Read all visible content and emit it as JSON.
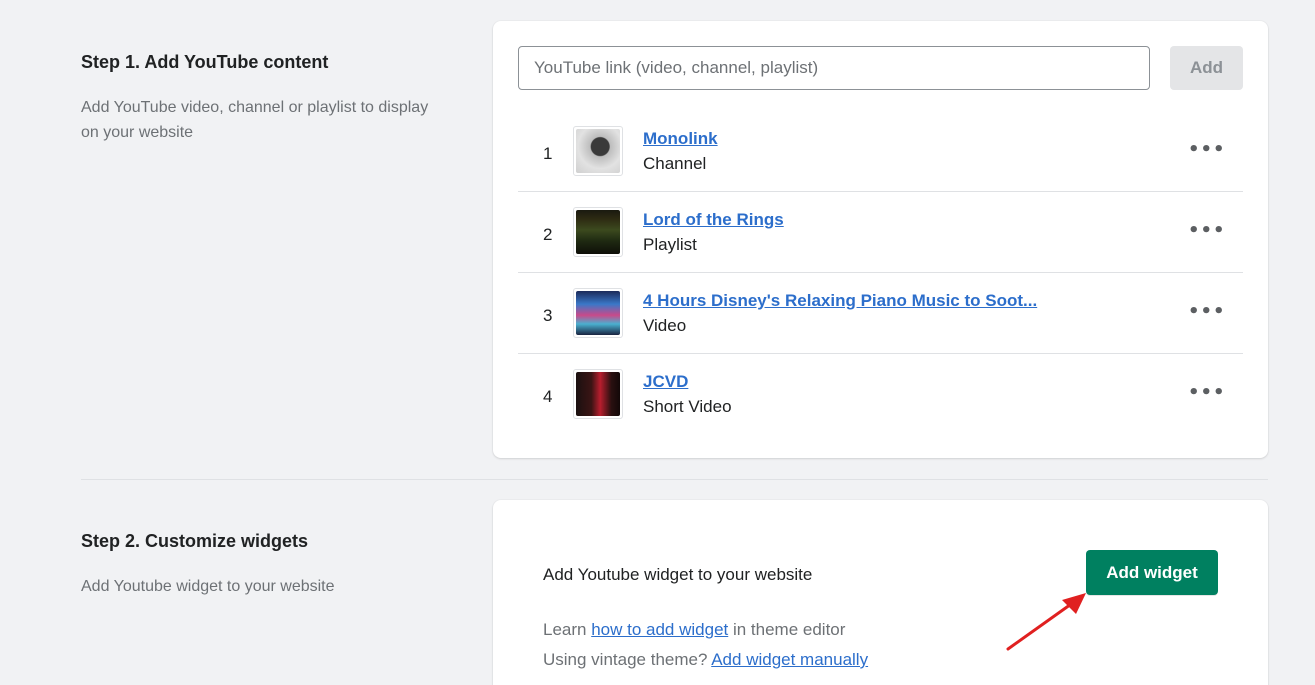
{
  "step1": {
    "title": "Step 1. Add YouTube content",
    "description": "Add YouTube video, channel or playlist to display on your website",
    "input_placeholder": "YouTube link (video, channel, playlist)",
    "add_label": "Add",
    "items": [
      {
        "num": "1",
        "title": "Monolink",
        "type": "Channel",
        "thumb": "avatar-gray"
      },
      {
        "num": "2",
        "title": "Lord of the Rings",
        "type": "Playlist",
        "thumb": "dark-green"
      },
      {
        "num": "3",
        "title": "4 Hours Disney's Relaxing Piano Music to Soot...",
        "type": "Video",
        "thumb": "colorful"
      },
      {
        "num": "4",
        "title": "JCVD",
        "type": "Short Video",
        "thumb": "dark-red"
      }
    ]
  },
  "step2": {
    "title": "Step 2. Customize widgets",
    "description": "Add Youtube widget to your website",
    "widget_text": "Add Youtube widget to your website",
    "button_label": "Add widget",
    "learn_prefix": "Learn ",
    "learn_link": "how to add widget",
    "learn_suffix": " in theme editor",
    "vintage_prefix": "Using vintage theme? ",
    "vintage_link": "Add widget manually"
  },
  "colors": {
    "primary": "#008060",
    "link": "#2c6ecb",
    "arrow": "#e02020"
  },
  "icons": {
    "more": "horizontal-dots-icon",
    "annotation": "red-arrow-icon"
  }
}
